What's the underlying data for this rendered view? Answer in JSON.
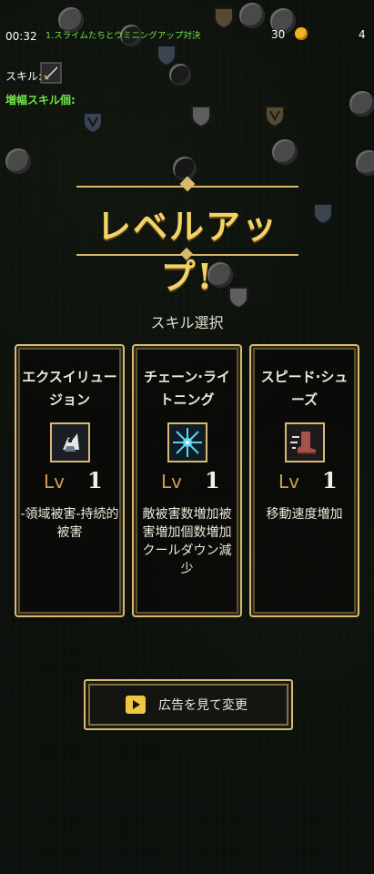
{
  "hud": {
    "timer": "00:32",
    "stage": "1.スライムたちとウミニングアップ対決",
    "coins": "30",
    "right_counter": "4",
    "skill_label": "スキル:",
    "boost_label": "増幅スキル個:"
  },
  "title": "レベルアップ!",
  "select_title": "スキル選択",
  "level_prefix": "Lv",
  "cards": [
    {
      "name": "エクスイリュージョン",
      "icon": "exillusion-icon",
      "level": "1",
      "description": "-領域被害-持続的被害"
    },
    {
      "name": "チェーン·ライトニング",
      "icon": "chain-lightning-icon",
      "level": "1",
      "description": "敵被害数増加被害増加個数増加クールダウン減少"
    },
    {
      "name": "スピード·シューズ",
      "icon": "speed-shoes-icon",
      "level": "1",
      "description": "移動速度増加"
    }
  ],
  "ad_button": {
    "label": "広告を見て変更"
  },
  "colors": {
    "gold": "#d8b873",
    "title": "#f1d36a",
    "green": "#70e24a"
  }
}
